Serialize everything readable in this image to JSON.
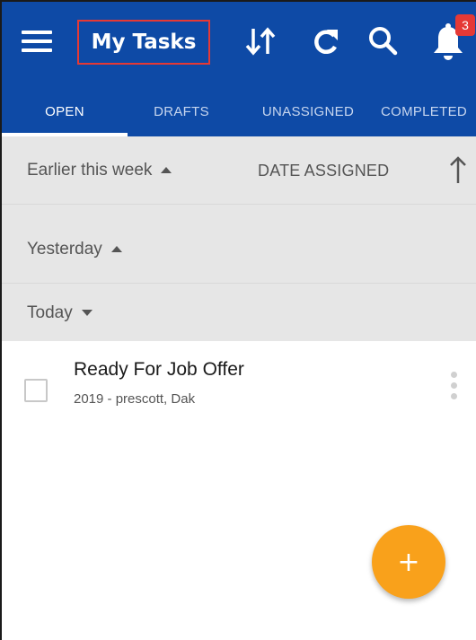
{
  "appbar": {
    "title": "My Tasks",
    "notification_count": "3",
    "icons": [
      "menu-icon",
      "sort-icon",
      "refresh-icon",
      "search-icon",
      "bell-icon"
    ]
  },
  "tabs": [
    {
      "label": "OPEN",
      "active": true
    },
    {
      "label": "DRAFTS",
      "active": false
    },
    {
      "label": "UNASSIGNED",
      "active": false
    },
    {
      "label": "COMPLETED",
      "active": false
    }
  ],
  "groups": {
    "earlier": "Earlier this week",
    "yesterday": "Yesterday",
    "today": "Today",
    "sort_label": "DATE ASSIGNED"
  },
  "tasks": [
    {
      "title": "Ready For Job Offer",
      "subtitle": "2019 - prescott, Dak"
    }
  ],
  "fab": {
    "label": "+"
  },
  "colors": {
    "appbar": "#0e4aa6",
    "accent": "#f9a11b",
    "badge": "#e53935",
    "groups_bg": "#e6e6e6"
  }
}
